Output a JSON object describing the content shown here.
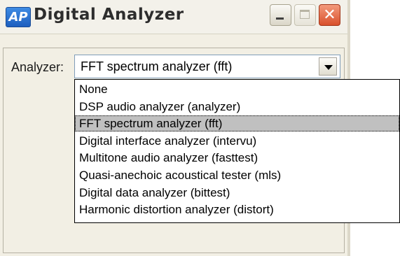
{
  "window": {
    "icon_text": "AP",
    "title": "Digital Analyzer",
    "buttons": {
      "minimize": "minimize-icon",
      "maximize": "maximize-icon",
      "close": "close-icon"
    }
  },
  "analyzer_field": {
    "label": "Analyzer:",
    "value": "FFT spectrum analyzer (fft)"
  },
  "dropdown": {
    "selected_index": 2,
    "options": [
      "None",
      "DSP audio analyzer (analyzer)",
      "FFT spectrum analyzer (fft)",
      "Digital interface analyzer (intervu)",
      "Multitone audio analyzer (fasttest)",
      "Quasi-anechoic acoustical tester (mls)",
      "Digital data analyzer (bittest)",
      "Harmonic distortion analyzer (distort)"
    ]
  },
  "colors": {
    "selection": "#c0c0c0",
    "close_button": "#d9502c",
    "window_face": "#f2efe4"
  }
}
